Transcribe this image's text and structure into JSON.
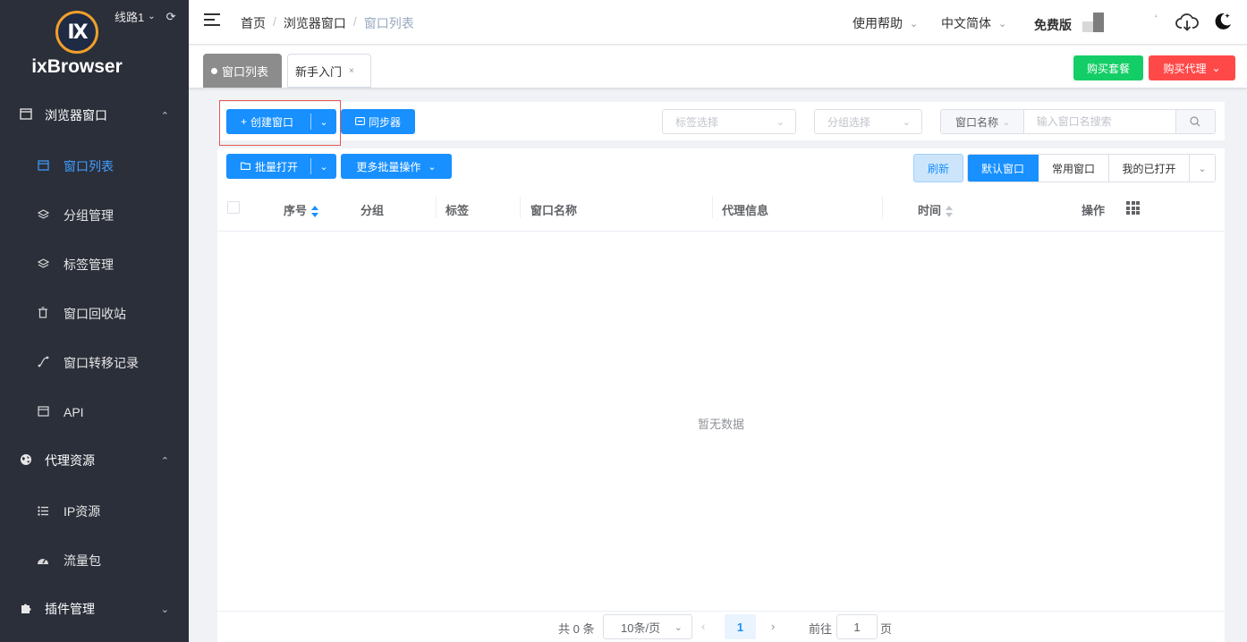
{
  "sidebar": {
    "logo_mark": "IX",
    "app_name": "ixBrowser",
    "route_label": "线路1",
    "groups": {
      "browser": {
        "label": "浏览器窗口",
        "icon": "window-icon"
      },
      "proxy": {
        "label": "代理资源",
        "icon": "globe-icon"
      },
      "plugin": {
        "label": "插件管理",
        "icon": "puzzle-icon"
      }
    },
    "items": {
      "window_list": {
        "label": "窗口列表",
        "icon": "window-icon",
        "active": true
      },
      "group_mgmt": {
        "label": "分组管理",
        "icon": "layers-icon"
      },
      "tag_mgmt": {
        "label": "标签管理",
        "icon": "layers-icon"
      },
      "recycle": {
        "label": "窗口回收站",
        "icon": "trash-icon"
      },
      "transfer": {
        "label": "窗口转移记录",
        "icon": "transfer-icon"
      },
      "api": {
        "label": "API",
        "icon": "window-icon"
      },
      "ip_res": {
        "label": "IP资源",
        "icon": "list-icon"
      },
      "traffic": {
        "label": "流量包",
        "icon": "dashboard-icon"
      }
    }
  },
  "header": {
    "breadcrumb": [
      "首页",
      "浏览器窗口",
      "窗口列表"
    ],
    "help": "使用帮助",
    "language": "中文简体",
    "plan": "免费版"
  },
  "tabs": {
    "active": "窗口列表",
    "other": "新手入门",
    "close_glyph": "×",
    "buy_package": "购买套餐",
    "buy_proxy": "购买代理"
  },
  "toolbar": {
    "create_window": "创建窗口",
    "sync": "同步器",
    "tag_select_placeholder": "标签选择",
    "group_select_placeholder": "分组选择",
    "search_field": "窗口名称",
    "search_placeholder": "输入窗口名搜索",
    "batch_open": "批量打开",
    "more_batch": "更多批量操作",
    "refresh": "刷新",
    "seg_default": "默认窗口",
    "seg_common": "常用窗口",
    "seg_opened": "我的已打开"
  },
  "table": {
    "columns": [
      "序号",
      "分组",
      "标签",
      "窗口名称",
      "代理信息",
      "时间",
      "操作"
    ],
    "empty_text": "暂无数据",
    "rows": []
  },
  "pager": {
    "total": "共 0 条",
    "page_size": "10条/页",
    "current_page": "1",
    "goto_label": "前往",
    "goto_value": "1",
    "page_unit": "页"
  },
  "colors": {
    "sidebar_bg": "#2b2f3a",
    "primary": "#1890ff",
    "success": "#13ce66",
    "danger": "#ff4949",
    "highlight": "#e55757"
  }
}
